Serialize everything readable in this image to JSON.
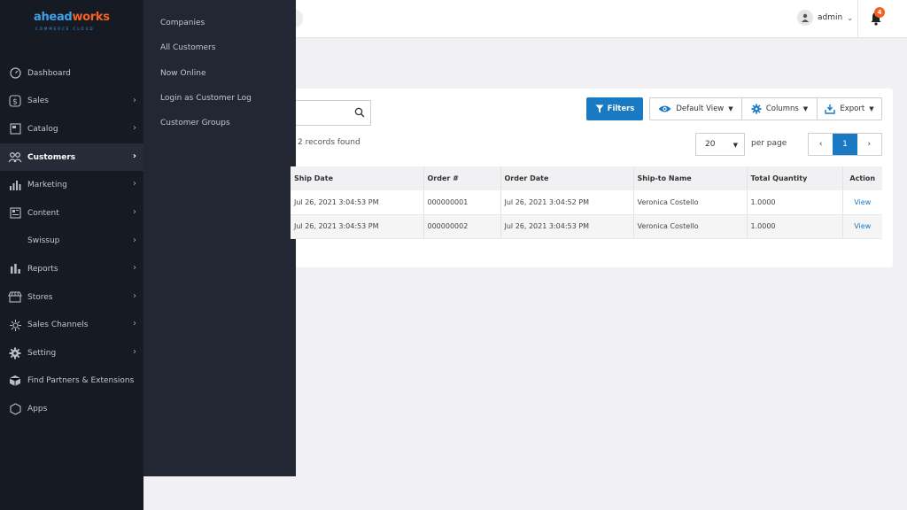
{
  "header": {
    "user_label": "admin",
    "notification_count": "4"
  },
  "sidebar": {
    "logo": {
      "part1": "ahead",
      "part2": "works",
      "tagline": "COMMERCE CLOUD"
    },
    "items": [
      {
        "label": "Dashboard",
        "icon": "dashboard-icon"
      },
      {
        "label": "Sales",
        "icon": "dollar-icon"
      },
      {
        "label": "Catalog",
        "icon": "catalog-icon"
      },
      {
        "label": "Customers",
        "icon": "customers-icon"
      },
      {
        "label": "Marketing",
        "icon": "marketing-icon"
      },
      {
        "label": "Content",
        "icon": "content-icon"
      },
      {
        "label": "Swissup",
        "icon": ""
      },
      {
        "label": "Reports",
        "icon": "reports-icon"
      },
      {
        "label": "Stores",
        "icon": "stores-icon"
      },
      {
        "label": "Sales Channels",
        "icon": "channels-icon"
      },
      {
        "label": "Setting",
        "icon": "gear-icon"
      },
      {
        "label": "Find Partners & Extensions",
        "icon": "partners-icon"
      },
      {
        "label": "Apps",
        "icon": "apps-icon"
      }
    ]
  },
  "flyout": {
    "items": [
      "Companies",
      "All Customers",
      "Now Online",
      "Login as Customer Log",
      "Customer Groups"
    ]
  },
  "toolbar": {
    "filters_label": "Filters",
    "view_label": "Default View",
    "columns_label": "Columns",
    "export_label": "Export",
    "records_found": "2 records found",
    "per_page_value": "20",
    "per_page_label": "per page",
    "current_page": "1"
  },
  "table": {
    "columns": [
      "Ship Date",
      "Order #",
      "Order Date",
      "Ship-to Name",
      "Total Quantity",
      "Action"
    ],
    "rows": [
      {
        "ship_date": "Jul 26, 2021 3:04:53 PM",
        "order": "000000001",
        "order_date": "Jul 26, 2021 3:04:52 PM",
        "ship_to": "Veronica Costello",
        "qty": "1.0000",
        "action": "View"
      },
      {
        "ship_date": "Jul 26, 2021 3:04:53 PM",
        "order": "000000002",
        "order_date": "Jul 26, 2021 3:04:53 PM",
        "ship_to": "Veronica Costello",
        "qty": "1.0000",
        "action": "View"
      }
    ]
  },
  "colors": {
    "sidebar_bg": "#161a23",
    "flyout_bg": "#222733",
    "accent_blue": "#1979c3",
    "badge_orange": "#f26322"
  }
}
